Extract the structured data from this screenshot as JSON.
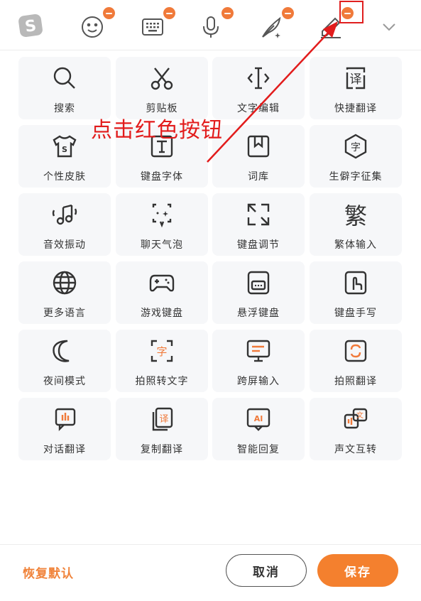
{
  "toolbar": {
    "items": [
      {
        "icon": "sogou-logo-icon",
        "removable": false
      },
      {
        "icon": "emoji-icon",
        "removable": true
      },
      {
        "icon": "keyboard-icon",
        "removable": true
      },
      {
        "icon": "microphone-icon",
        "removable": true
      },
      {
        "icon": "quill-icon",
        "removable": true
      },
      {
        "icon": "edit-pen-icon",
        "removable": true
      },
      {
        "icon": "chevron-down-icon",
        "removable": false
      }
    ]
  },
  "annotation": {
    "text": "点击红色按钮",
    "color": "#e21c1c"
  },
  "grid": {
    "items": [
      {
        "icon": "search-icon",
        "label": "搜索"
      },
      {
        "icon": "scissors-icon",
        "label": "剪贴板"
      },
      {
        "icon": "text-cursor-icon",
        "label": "文字编辑"
      },
      {
        "icon": "quick-translate-icon",
        "label": "快捷翻译"
      },
      {
        "icon": "tshirt-skin-icon",
        "label": "个性皮肤"
      },
      {
        "icon": "font-t-icon",
        "label": "键盘字体"
      },
      {
        "icon": "bookmark-lexicon-icon",
        "label": "词库"
      },
      {
        "icon": "rare-char-icon",
        "label": "生僻字征集"
      },
      {
        "icon": "music-vibrate-icon",
        "label": "音效振动"
      },
      {
        "icon": "chat-bubble-icon",
        "label": "聊天气泡"
      },
      {
        "icon": "resize-icon",
        "label": "键盘调节"
      },
      {
        "icon": "traditional-char-icon",
        "label": "繁体输入"
      },
      {
        "icon": "globe-icon",
        "label": "更多语言"
      },
      {
        "icon": "gamepad-icon",
        "label": "游戏键盘"
      },
      {
        "icon": "floating-keyboard-icon",
        "label": "悬浮键盘"
      },
      {
        "icon": "handwriting-icon",
        "label": "键盘手写"
      },
      {
        "icon": "moon-icon",
        "label": "夜间模式"
      },
      {
        "icon": "photo-text-icon",
        "label": "拍照转文字"
      },
      {
        "icon": "cross-screen-icon",
        "label": "跨屏输入"
      },
      {
        "icon": "photo-translate-icon",
        "label": "拍照翻译"
      },
      {
        "icon": "dialog-translate-icon",
        "label": "对话翻译"
      },
      {
        "icon": "copy-translate-icon",
        "label": "复制翻译"
      },
      {
        "icon": "ai-reply-icon",
        "label": "智能回复"
      },
      {
        "icon": "voice-text-icon",
        "label": "声文互转"
      }
    ]
  },
  "footer": {
    "restore_label": "恢复默认",
    "cancel_label": "取消",
    "save_label": "保存"
  },
  "colors": {
    "accent": "#f4802e",
    "badge": "#f07a3a",
    "highlight": "#e01f1f"
  }
}
